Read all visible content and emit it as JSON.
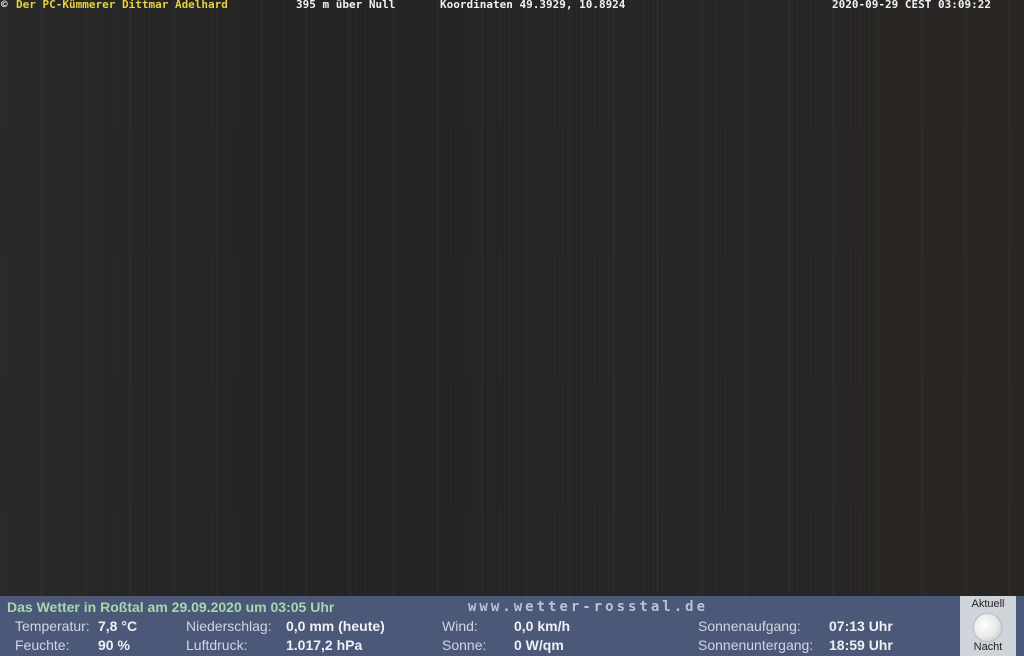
{
  "overlay": {
    "copyright_icon": "copyright-icon",
    "author": "Der PC-Kümmerer Dittmar Adelhard",
    "altitude": "395 m über Null",
    "coordinates": "Koordinaten 49.3929, 10.8924",
    "timestamp": "2020-09-29 CEST 03:09:22"
  },
  "weather": {
    "headline": "Das Wetter in Roßtal am 29.09.2020 um 03:05 Uhr",
    "website": "www.wetter-rosstal.de",
    "temperature_label": "Temperatur:",
    "temperature_value": "7,8 °C",
    "humidity_label": "Feuchte:",
    "humidity_value": "90 %",
    "precip_label": "Niederschlag:",
    "precip_value": "0,0 mm (heute)",
    "pressure_label": "Luftdruck:",
    "pressure_value": "1.017,2 hPa",
    "wind_label": "Wind:",
    "wind_value": "0,0 km/h",
    "sun_label": "Sonne:",
    "sun_value": "0 W/qm",
    "sunrise_label": "Sonnenaufgang:",
    "sunrise_value": "07:13 Uhr",
    "sunset_label": "Sonnenuntergang:",
    "sunset_value": "18:59 Uhr",
    "moon_top": "Aktuell",
    "moon_bottom": "Nacht",
    "moon_icon": "moon-icon"
  }
}
